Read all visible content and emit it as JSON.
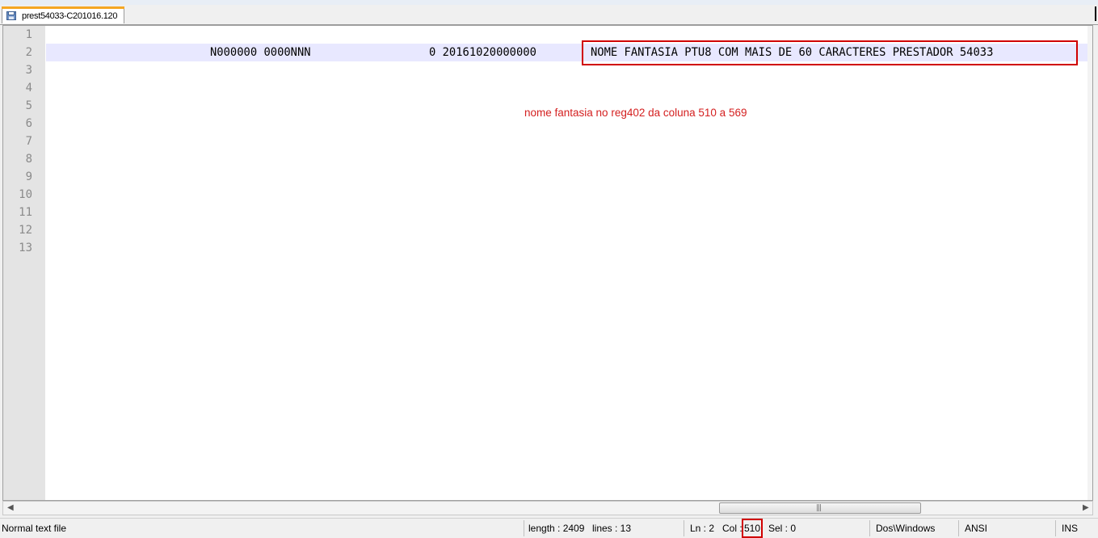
{
  "tab": {
    "label": "prest54033-C201016.120",
    "icon": "save-file-icon"
  },
  "editor": {
    "line_numbers": [
      "1",
      "2",
      "3",
      "4",
      "5",
      "6",
      "7",
      "8",
      "9",
      "10",
      "11",
      "12",
      "13"
    ],
    "line2": {
      "segment_a": "N000000 0000NNN",
      "segment_b": "0 20161020000000",
      "segment_c": "NOME FANTASIA PTU8 COM MAIS DE 60 CARACTERES PRESTADOR 54033"
    },
    "annotation": "nome fantasia no reg402 da coluna 510 a 569"
  },
  "scrollbar": {
    "left_arrow": "◀",
    "right_arrow": "▶",
    "grip": "|||"
  },
  "status": {
    "file_type": "Normal text file",
    "length": "length : 2409",
    "lines": "lines : 13",
    "ln": "Ln : 2",
    "col_label": "Col :",
    "col_value": "510",
    "sel": "Sel : 0",
    "eol": "Dos\\Windows",
    "encoding": "ANSI",
    "mode": "INS"
  },
  "colors": {
    "highlight": "#d00000",
    "current_line": "#e8e8ff",
    "annotation_text": "#d42020"
  }
}
